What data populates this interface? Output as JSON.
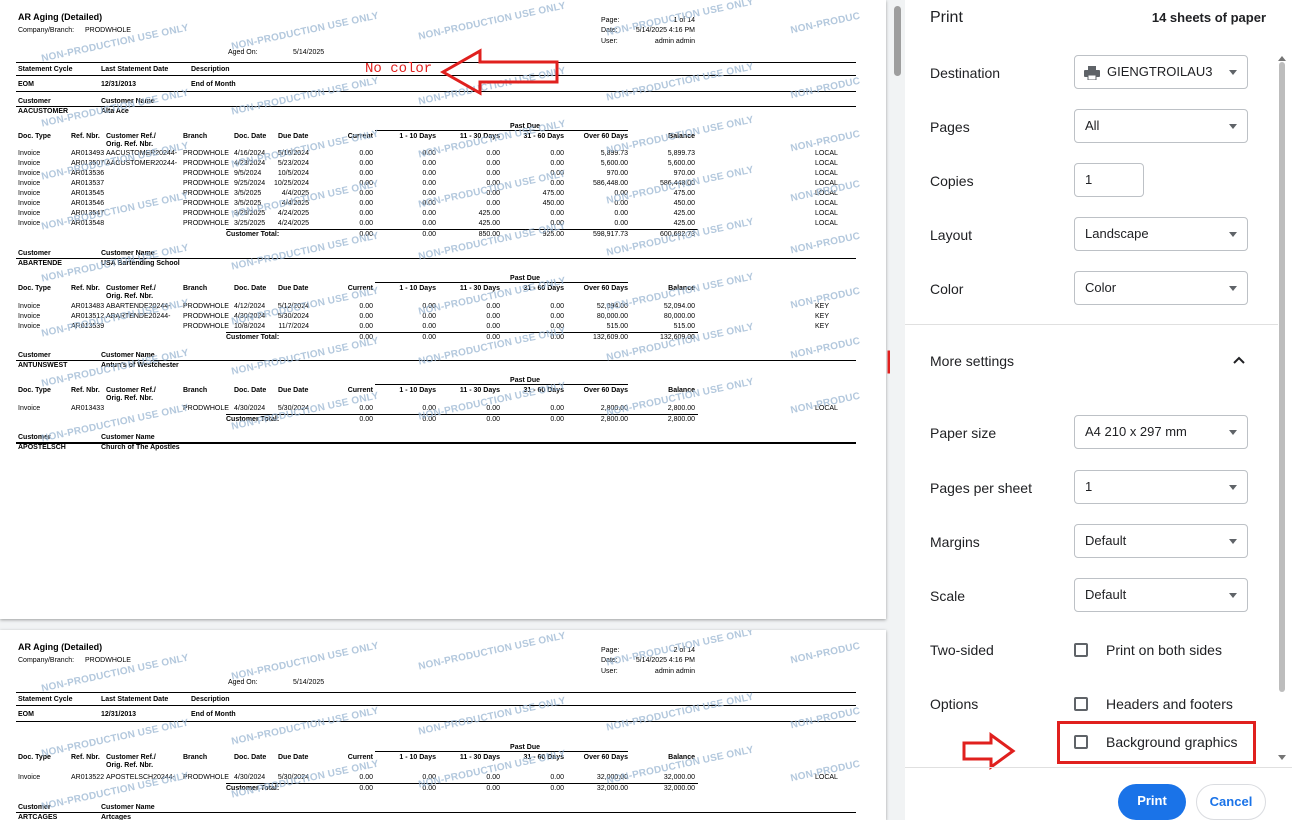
{
  "report": {
    "title": "AR Aging (Detailed)",
    "company_label": "Company/Branch:",
    "company": "PRODWHOLE",
    "aged_on_label": "Aged On:",
    "aged_on": "5/14/2025",
    "page_label": "Page:",
    "page1": "1 of 14",
    "page2": "2 of 14",
    "date_label": "Date:",
    "date": "5/14/2025 4:16 PM",
    "user_label": "User:",
    "user": "admin admin",
    "watermark": "NON-PRODUCTION USE ONLY",
    "watermark_cut": "NON-PRODUC",
    "header": {
      "statement_cycle": "Statement Cycle",
      "last_statement_date": "Last Statement Date",
      "description": "Description"
    },
    "cycle": {
      "code": "EOM",
      "date": "12/31/2013",
      "desc": "End of Month"
    },
    "cust_hdr": {
      "customer": "Customer",
      "name": "Customer Name"
    },
    "cols": {
      "doc_type": "Doc. Type",
      "ref_nbr": "Ref. Nbr.",
      "cust_ref": "Customer Ref./",
      "orig_ref": "Orig. Ref. Nbr.",
      "branch": "Branch",
      "doc_date": "Doc. Date",
      "due_date": "Due Date",
      "current": "Current",
      "d1_10": "1 - 10 Days",
      "d11_30": "11 - 30 Days",
      "d31_60": "31 - 60 Days",
      "over60": "Over 60 Days",
      "balance": "Balance",
      "past_due": "Past Due"
    },
    "total_label": "Customer Total:",
    "annotation": "No color",
    "customers": [
      {
        "id": "AACUSTOMER",
        "name": "Alta Ace",
        "rows": [
          [
            "Invoice",
            "AR013493",
            "AACUSTOMER20244-",
            "PRODWHOLE",
            "4/16/2024",
            "5/16/2024",
            "0.00",
            "0.00",
            "0.00",
            "0.00",
            "5,899.73",
            "5,899.73",
            "LOCAL"
          ],
          [
            "Invoice",
            "AR013507",
            "AACUSTOMER20244-",
            "PRODWHOLE",
            "4/23/2024",
            "5/23/2024",
            "0.00",
            "0.00",
            "0.00",
            "0.00",
            "5,600.00",
            "5,600.00",
            "LOCAL"
          ],
          [
            "Invoice",
            "AR013536",
            "",
            "PRODWHOLE",
            "9/5/2024",
            "10/5/2024",
            "0.00",
            "0.00",
            "0.00",
            "0.00",
            "970.00",
            "970.00",
            "LOCAL"
          ],
          [
            "Invoice",
            "AR013537",
            "",
            "PRODWHOLE",
            "9/25/2024",
            "10/25/2024",
            "0.00",
            "0.00",
            "0.00",
            "0.00",
            "586,448.00",
            "586,448.00",
            "LOCAL"
          ],
          [
            "Invoice",
            "AR013545",
            "",
            "PRODWHOLE",
            "3/5/2025",
            "4/4/2025",
            "0.00",
            "0.00",
            "0.00",
            "475.00",
            "0.00",
            "475.00",
            "LOCAL"
          ],
          [
            "Invoice",
            "AR013546",
            "",
            "PRODWHOLE",
            "3/5/2025",
            "4/4/2025",
            "0.00",
            "0.00",
            "0.00",
            "450.00",
            "0.00",
            "450.00",
            "LOCAL"
          ],
          [
            "Invoice",
            "AR013547",
            "",
            "PRODWHOLE",
            "3/25/2025",
            "4/24/2025",
            "0.00",
            "0.00",
            "425.00",
            "0.00",
            "0.00",
            "425.00",
            "LOCAL"
          ],
          [
            "Invoice",
            "AR013548",
            "",
            "PRODWHOLE",
            "3/25/2025",
            "4/24/2025",
            "0.00",
            "0.00",
            "425.00",
            "0.00",
            "0.00",
            "425.00",
            "LOCAL"
          ]
        ],
        "total": [
          "0.00",
          "0.00",
          "850.00",
          "925.00",
          "598,917.73",
          "600,692.73"
        ]
      },
      {
        "id": "ABARTENDE",
        "name": "USA Bartending School",
        "rows": [
          [
            "Invoice",
            "AR013483",
            "ABARTENDE20244-",
            "PRODWHOLE",
            "4/12/2024",
            "5/12/2024",
            "0.00",
            "0.00",
            "0.00",
            "0.00",
            "52,094.00",
            "52,094.00",
            "KEY"
          ],
          [
            "Invoice",
            "AR013512",
            "ABARTENDE20244-",
            "PRODWHOLE",
            "4/30/2024",
            "5/30/2024",
            "0.00",
            "0.00",
            "0.00",
            "0.00",
            "80,000.00",
            "80,000.00",
            "KEY"
          ],
          [
            "Invoice",
            "AR013539",
            "",
            "PRODWHOLE",
            "10/8/2024",
            "11/7/2024",
            "0.00",
            "0.00",
            "0.00",
            "0.00",
            "515.00",
            "515.00",
            "KEY"
          ]
        ],
        "total": [
          "0.00",
          "0.00",
          "0.00",
          "0.00",
          "132,609.00",
          "132,609.00"
        ]
      },
      {
        "id": "ANTUNSWEST",
        "name": "Antun's of Westchester",
        "rows": [
          [
            "Invoice",
            "AR013433",
            "",
            "PRODWHOLE",
            "4/30/2024",
            "5/30/2024",
            "0.00",
            "0.00",
            "0.00",
            "0.00",
            "2,800.00",
            "2,800.00",
            "LOCAL"
          ]
        ],
        "total": [
          "0.00",
          "0.00",
          "0.00",
          "0.00",
          "2,800.00",
          "2,800.00"
        ]
      },
      {
        "id": "APOSTELSCH",
        "name": "Church of The Apostles",
        "rows": [],
        "total": []
      }
    ],
    "page2_customers": [
      {
        "id": "APOSTELSCH",
        "rows": [
          [
            "Invoice",
            "AR013522",
            "APOSTELSCH20244-",
            "PRODWHOLE",
            "4/30/2024",
            "5/30/2024",
            "0.00",
            "0.00",
            "0.00",
            "0.00",
            "32,000.00",
            "32,000.00",
            "LOCAL"
          ]
        ],
        "total": [
          "0.00",
          "0.00",
          "0.00",
          "0.00",
          "32,000.00",
          "32,000.00"
        ]
      },
      {
        "id": "ARTCAGES",
        "name": "Artcages",
        "rows": [],
        "total": []
      }
    ]
  },
  "print": {
    "title": "Print",
    "sheets": "14 sheets of paper",
    "destination_label": "Destination",
    "destination": "GIENGTROILAU3",
    "pages_label": "Pages",
    "pages": "All",
    "copies_label": "Copies",
    "copies": "1",
    "layout_label": "Layout",
    "layout": "Landscape",
    "color_label": "Color",
    "color": "Color",
    "more_settings": "More settings",
    "paper_size_label": "Paper size",
    "paper_size": "A4 210 x 297 mm",
    "pps_label": "Pages per sheet",
    "pps": "1",
    "margins_label": "Margins",
    "margins": "Default",
    "scale_label": "Scale",
    "scale": "Default",
    "two_sided_label": "Two-sided",
    "two_sided_option": "Print on both sides",
    "options_label": "Options",
    "headers_footers": "Headers and footers",
    "background_graphics": "Background graphics",
    "print_button": "Print",
    "cancel_button": "Cancel"
  },
  "colors": {
    "accent": "#1a73e8",
    "annotation_red": "#e0201e",
    "watermark": "#9ab6d2"
  },
  "icons": {
    "printer": "printer-icon",
    "collapse": "chevron-up-icon",
    "arrow": "red-arrow-icon"
  }
}
